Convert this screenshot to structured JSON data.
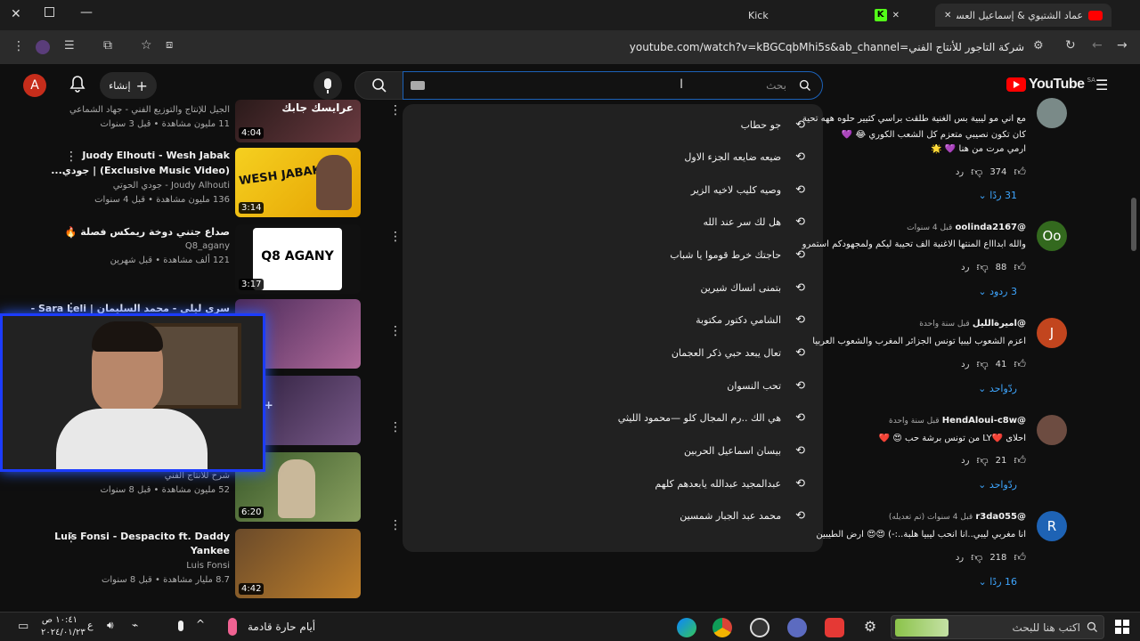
{
  "browser": {
    "tabs": [
      {
        "title": "عماد الشتيوي & إسماعيل العسكر",
        "active": true
      },
      {
        "title": "Kick",
        "active": false
      }
    ],
    "url": "youtube.com/watch?v=kBGCqbMhi5s&ab_channel=شركة التاجور للأنتاج الفني"
  },
  "youtube": {
    "logo_text": "YouTube",
    "region": "SA",
    "search_placeholder": "بحث",
    "create_label": "إنشاء",
    "avatar_letter": "A",
    "suggestions": [
      "جو حطاب",
      "ضيعه ضايعه الجزء الاول",
      "وصيه كليب لاخيه الزير",
      "هل لك سر عند الله",
      "حاجتك خرط قوموا يا شباب",
      "بتمنى انساك شيرين",
      "الشامي دكتور مكتوبة",
      "تعال يبعد حبي ذكر العجمان",
      "تحب النسوان",
      "هي الك ..رم المجال كلو —محمود الليثي",
      "بيسان اسماعيل الحربين",
      "عبدالمجيد عبدالله يابعدهم كلهم",
      "محمد عبد الجبار شمسين"
    ],
    "videos": [
      {
        "title": "",
        "channel": "الجيل للإنتاج والتوزيع الفني - جهاد الشماعي",
        "meta": "11 مليون مشاهدة • قبل 3 سنوات",
        "duration": "4:04",
        "thumb_text": "عرايسك جابك"
      },
      {
        "title": "Juody Elhouti - Wesh Jabak",
        "title2": "(Exclusive Music Video) | جودي...",
        "channel": "Joudy Alhouti - جودي الحوتي",
        "meta": "136 مليون مشاهدة • قبل 4 سنوات",
        "duration": "3:14",
        "thumb_text": "WESH JABAK"
      },
      {
        "title": "صداع جتني دوخة ريمكس فصلة 🔥",
        "channel": "Q8_agany",
        "meta": "121 ألف مشاهدة • قبل شهرين",
        "duration": "3:17",
        "thumb_text": "Q8 AGANY"
      },
      {
        "title": "سرى ليلي - محمد السليمان | Sara Leli -",
        "channel": "",
        "meta": "",
        "duration": "",
        "thumb_text": ""
      },
      {
        "title": "",
        "channel": "",
        "meta": "",
        "duration": "",
        "thumb_text": "80M+"
      },
      {
        "title": "",
        "channel": "شرح للأنتاج الفني",
        "meta": "52 مليون مشاهدة • قبل 8 سنوات",
        "duration": "6:20",
        "thumb_text": ""
      },
      {
        "title": "Luis Fonsi - Despacito ft. Daddy",
        "title2": "Yankee",
        "channel": "Luis Fonsi",
        "meta": "8.7 مليار مشاهدة • قبل 8 سنوات",
        "duration": "4:42",
        "thumb_text": ""
      }
    ],
    "comments": [
      {
        "handle": "",
        "age": "",
        "text1": "مع اني مو ليبية بس الغنية طلقت براسي كثيير حلوه ههه تحية",
        "text2": "كان تكون نصيبي متعزم كل الشعب الكوري 😂 💜",
        "text3": "ارمي مرت من هنا 💜 🌟",
        "likes": "374",
        "reply_label": "رد",
        "replies": "31 ردًا",
        "avatar_letter": "",
        "avatar_color": "#8aa"
      },
      {
        "handle": "@oolinda2167",
        "age": "قبل 4 سنوات",
        "text1": "والله ابداااع المنتها الاغنية الف تحيبة ليكم ولمجهودكم استمرو",
        "likes": "88",
        "reply_label": "رد",
        "replies": "3 ردود",
        "avatar_letter": "Oo",
        "avatar_color": "#33691e"
      },
      {
        "handle": "@اميرةالليل",
        "age": "قبل سنة واحدة",
        "text1": "اعزم الشعوب ليبيا تونس الجزائر المغرب والشعوب العربيا",
        "likes": "41",
        "reply_label": "رد",
        "replies": "ردّواحد",
        "avatar_letter": "J",
        "avatar_color": "#c2451e"
      },
      {
        "handle": "@HendAloui-c8w",
        "age": "قبل سنة واحدة",
        "text1": "احلاى ❤️LY من تونس برشة حب 😍 ❤️",
        "likes": "21",
        "reply_label": "رد",
        "replies": "ردّواحد",
        "avatar_letter": "",
        "avatar_color": "#6d4c41"
      },
      {
        "handle": "@r3da055",
        "age": "قبل 4 سنوات (تم تعديله)",
        "text1": "انا مغربي ليبي..انا انحب ليبيا هلبة..:-) 😍😍 ارض الطيبين",
        "likes": "218",
        "reply_label": "رد",
        "replies": "16 ردًا",
        "avatar_letter": "R",
        "avatar_color": "#1e63b5"
      }
    ]
  },
  "taskbar": {
    "search_placeholder": "اكتب هنا للبحث",
    "weather": "أيام حارة قادمة",
    "time": "١٠:٤١ ص",
    "date": "٢٠٢٤/٠١/٢٣",
    "lang": "ع"
  },
  "colors": {
    "yt_red": "#ff0000",
    "link_blue": "#3ea6ff",
    "accent_border": "#1c62b9"
  }
}
